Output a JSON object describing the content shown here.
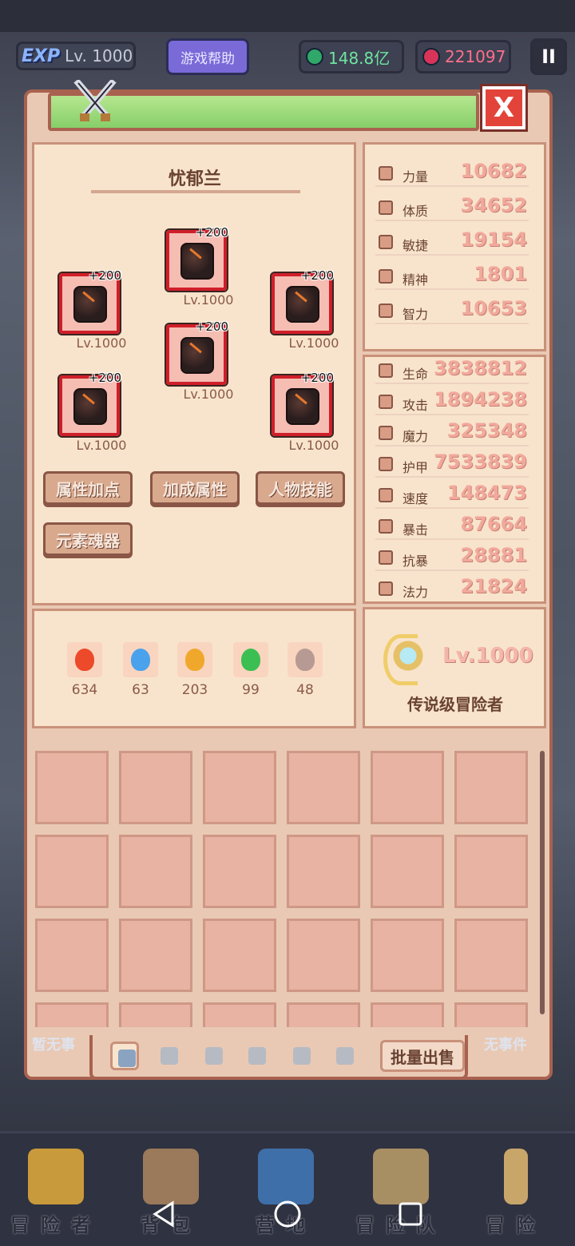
{
  "hud": {
    "exp_word": "EXP",
    "level": "Lv. 1000",
    "help_label": "游戏帮助",
    "currency_green": "148.8亿",
    "currency_red": "221097",
    "pause_label": "II"
  },
  "character": {
    "name": "忧郁兰",
    "close_label": "X",
    "equipment": [
      {
        "plus": "+200",
        "level": "Lv.1000"
      },
      {
        "plus": "+200",
        "level": "Lv.1000"
      },
      {
        "plus": "+200",
        "level": "Lv.1000"
      },
      {
        "plus": "+200",
        "level": "Lv.1000"
      },
      {
        "plus": "+200",
        "level": "Lv.1000"
      },
      {
        "plus": "+200",
        "level": "Lv.1000"
      }
    ],
    "buttons": {
      "attr_points": "属性加点",
      "bonus_attr": "加成属性",
      "char_skills": "人物技能",
      "element_soul": "元素魂器"
    },
    "elements": [
      {
        "name": "fire",
        "count": "634",
        "color": "#ec4a2a"
      },
      {
        "name": "water",
        "count": "63",
        "color": "#4aa2ec"
      },
      {
        "name": "lightning",
        "count": "203",
        "color": "#f0a82c"
      },
      {
        "name": "nature",
        "count": "99",
        "color": "#3cbf52"
      },
      {
        "name": "dark",
        "count": "48",
        "color": "#b79a93"
      }
    ]
  },
  "base_stats": [
    {
      "label": "力量",
      "value": "10682"
    },
    {
      "label": "体质",
      "value": "34652"
    },
    {
      "label": "敏捷",
      "value": "19154"
    },
    {
      "label": "精神",
      "value": "1801"
    },
    {
      "label": "智力",
      "value": "10653"
    }
  ],
  "combat_stats": [
    {
      "label": "生命",
      "value": "3838812"
    },
    {
      "label": "攻击",
      "value": "1894238"
    },
    {
      "label": "魔力",
      "value": "325348"
    },
    {
      "label": "护甲",
      "value": "7533839"
    },
    {
      "label": "速度",
      "value": "148473"
    },
    {
      "label": "暴击",
      "value": "87664"
    },
    {
      "label": "抗暴",
      "value": "28881"
    },
    {
      "label": "法力",
      "value": "21824"
    }
  ],
  "rank": {
    "level": "Lv.1000",
    "title": "传说级冒险者"
  },
  "inventory": {
    "bulk_sell": "批量出售",
    "side_left": "暂无事",
    "side_right": "无事件"
  },
  "nav": {
    "items": [
      {
        "label": "冒险者",
        "icon": "crown-icon",
        "color": "#c99a3b"
      },
      {
        "label": "背包",
        "icon": "backpack-icon",
        "color": "#9a7a5a"
      },
      {
        "label": "营地",
        "icon": "camp-icon",
        "color": "#3f6fa8"
      },
      {
        "label": "冒险队",
        "icon": "book-icon",
        "color": "#a88e63"
      },
      {
        "label": "冒险",
        "icon": "sword-icon",
        "color": "#c8a66a"
      }
    ]
  }
}
